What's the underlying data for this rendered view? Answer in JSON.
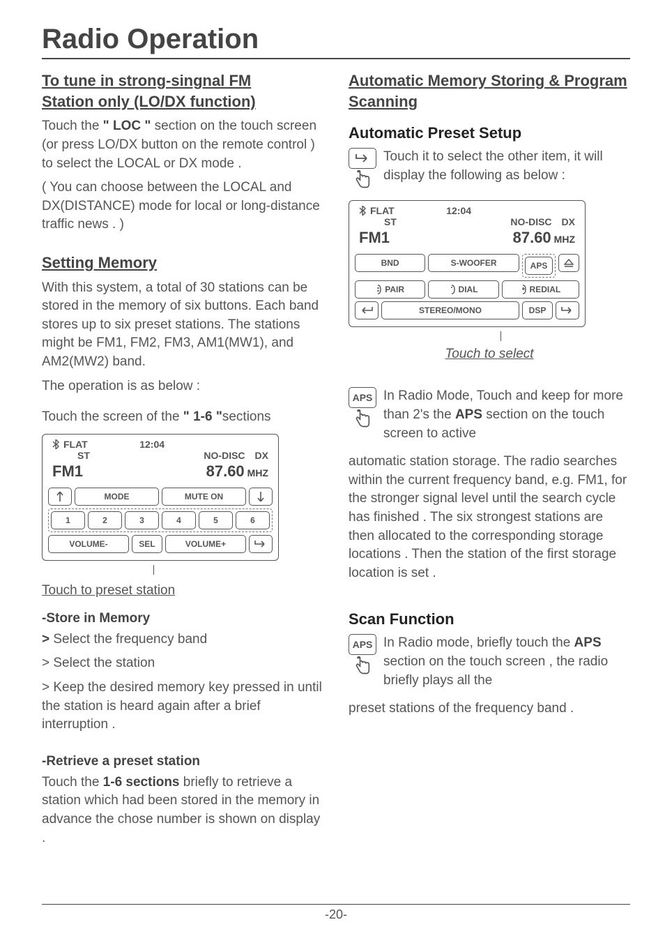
{
  "title": "Radio Operation",
  "left": {
    "h2a": "To tune in strong-singnal FM",
    "h2b": " Station only (LO/DX function)",
    "p1a": "Touch the ",
    "p1loc": "\" LOC \"",
    "p1b": " section on the touch screen (or press LO/DX button on the remote control ) to select the LOCAL or DX mode .",
    "p2": "( You can choose between the LOCAL and DX(DISTANCE)  mode for local or long-distance traffic news . )",
    "h2c": "Setting Memory",
    "p3": "With this system, a total of 30 stations can be stored in the memory of six buttons. Each band stores up to six preset stations. The stations might be FM1,  FM2,  FM3,  AM1(MW1), and AM2(MW2) band.",
    "p4": "The operation is as below :",
    "p5a": "Touch the screen of the ",
    "p5b": "\" 1-6 \"",
    "p5c": "sections",
    "panel1": {
      "flat": "FLAT",
      "st": "ST",
      "time": "12:04",
      "nodisc": "NO-DISC",
      "dx": "DX",
      "band": "FM1",
      "freq": "87.60",
      "unit": "MHZ",
      "mode": "MODE",
      "muteon": "MUTE ON",
      "nums": [
        "1",
        "2",
        "3",
        "4",
        "5",
        "6"
      ],
      "volm": "VOLUME-",
      "sel": "SEL",
      "volp": "VOLUME+"
    },
    "cap1": "Touch to preset station",
    "sh1": "-Store in Memory",
    "st1": "> Select the frequency band",
    "st2": "> Select the station",
    "st3": "> Keep the desired memory key pressed in until the station is heard again after a brief interruption .",
    "sh2": "-Retrieve a preset station",
    "rp1a": "Touch the ",
    "rp1b": "1-6 sections",
    "rp1c": " briefly to retrieve a station which had been stored in the memory in advance the chose number is shown on display ."
  },
  "right": {
    "h2a": "Automatic Memory Storing & Program Scanning",
    "h3a": "Automatic Preset Setup",
    "ip1": "Touch it to select the other item, it will display the following as below :",
    "panel2": {
      "flat": "FLAT",
      "st": "ST",
      "time": "12:04",
      "nodisc": "NO-DISC",
      "dx": "DX",
      "band": "FM1",
      "freq": "87.60",
      "unit": "MHZ",
      "bnd": "BND",
      "swoof": "S-WOOFER",
      "aps": "APS",
      "pair": "PAIR",
      "dial": "DIAL",
      "redial": "REDIAL",
      "stereo": "STEREO/MONO",
      "dsp": "DSP"
    },
    "cap2": "Touch to select",
    "aps_label": "APS",
    "ap1a": "In Radio Mode, Touch and keep for more than 2's the ",
    "ap1aps": "APS",
    "ap1b": " section on the touch screen to active",
    "ap2": "automatic station storage. The radio searches within the current frequency band, e.g. FM1, for the stronger signal level until the search cycle has finished . The six strongest stations are then allocated to the corresponding storage locations . Then the station of the first storage location is set .",
    "h3b": "Scan Function",
    "sf1a": "In Radio mode, briefly touch the ",
    "sf1aps": "APS",
    "sf1b": " section on the touch screen ,  the radio briefly plays all the",
    "sf2": "preset stations of the frequency band ."
  },
  "pagenum": "-20-"
}
